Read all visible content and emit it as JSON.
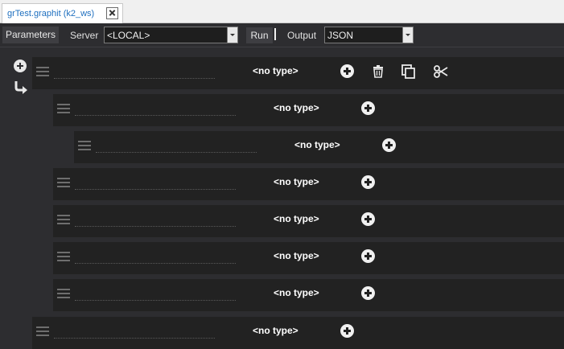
{
  "tab": {
    "title": "grTest.graphit (k2_ws)"
  },
  "toolbar": {
    "parameters_label": "Parameters",
    "server_label": "Server",
    "server_value": "<LOCAL>",
    "run_label": "Run",
    "output_label": "Output",
    "output_value": "JSON"
  },
  "rows": [
    {
      "type": "<no type>",
      "level": 0
    },
    {
      "type": "<no type>",
      "level": 1
    },
    {
      "type": "<no type>",
      "level": 2
    },
    {
      "type": "<no type>",
      "level": 1
    },
    {
      "type": "<no type>",
      "level": 1
    },
    {
      "type": "<no type>",
      "level": 1
    },
    {
      "type": "<no type>",
      "level": 1
    },
    {
      "type": "<no type>",
      "level": 0
    }
  ],
  "icons": {
    "gutter_add": "plus-circle-icon",
    "gutter_return": "return-arrow-icon",
    "row_add": "plus-circle-icon",
    "row_delete": "trash-icon",
    "row_copy": "copy-icon",
    "row_cut": "scissors-icon",
    "row_handle": "drag-handle-icon"
  }
}
